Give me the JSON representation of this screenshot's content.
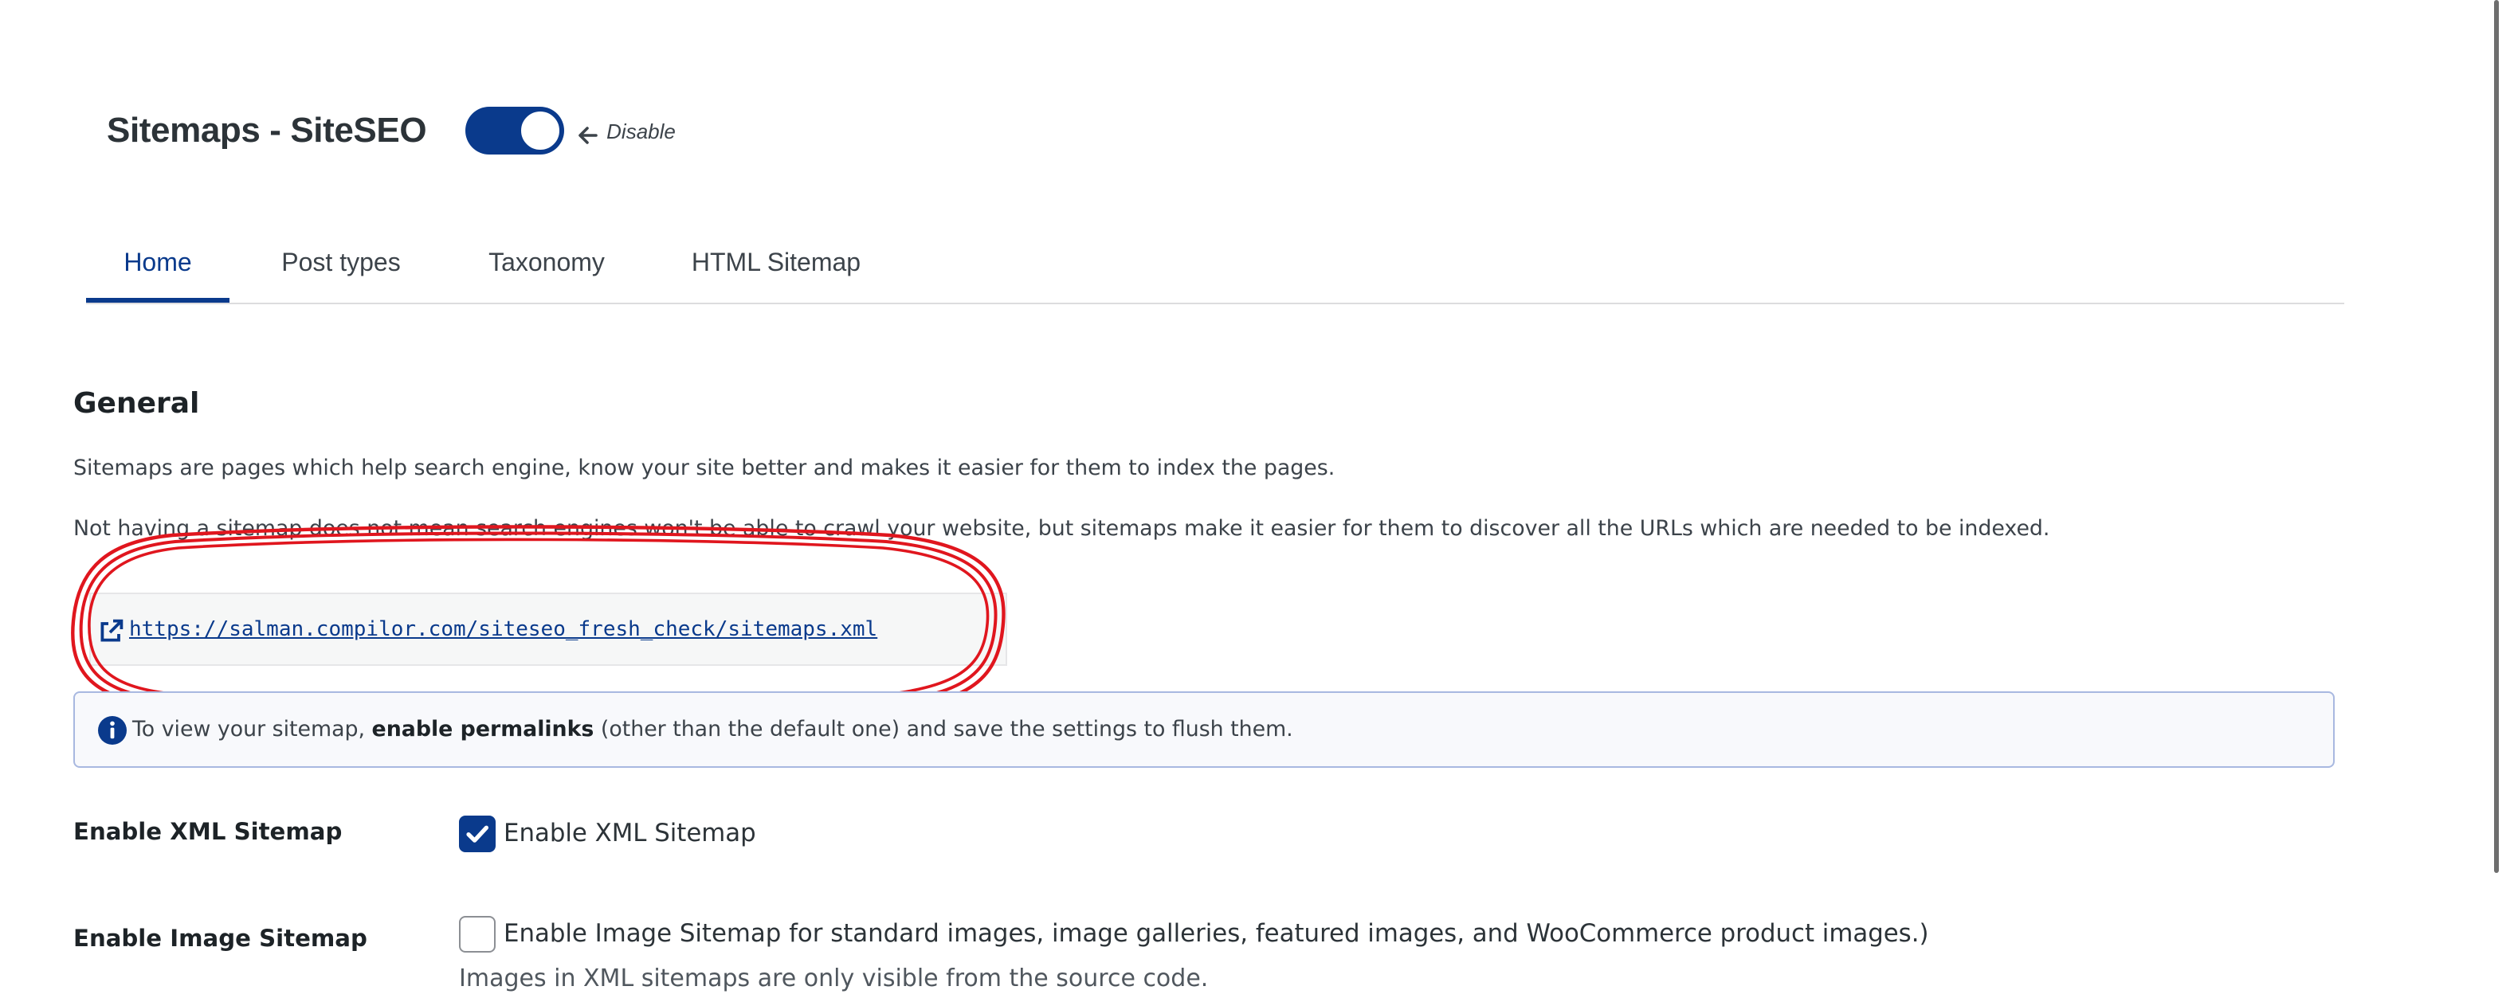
{
  "header": {
    "title": "Sitemaps - SiteSEO",
    "toggle_label": "Disable",
    "toggle_on": true,
    "accent_color": "#0a3a8c"
  },
  "tabs": [
    {
      "label": "Home",
      "active": true
    },
    {
      "label": "Post types",
      "active": false
    },
    {
      "label": "Taxonomy",
      "active": false
    },
    {
      "label": "HTML Sitemap",
      "active": false
    }
  ],
  "general": {
    "title": "General",
    "description_1": "Sitemaps are pages which help search engine, know your site better and makes it easier for them to index the pages.",
    "description_2": "Not having a sitemap does not mean search engines won't be able to crawl your website, but sitemaps make it easier for them to discover all the URLs which are needed to be indexed.",
    "sitemap_url": "https://salman.compilor.com/siteseo_fresh_check/sitemaps.xml",
    "link_icon": "external-link-icon",
    "highlight_color": "#e0161e"
  },
  "notice": {
    "icon": "info-icon",
    "text_before": "To view your sitemap, ",
    "text_bold": "enable permalinks",
    "text_after": " (other than the default one) and save the settings to flush them."
  },
  "settings": {
    "xml_sitemap": {
      "label": "Enable XML Sitemap",
      "checkbox_label": "Enable XML Sitemap",
      "checked": true
    },
    "image_sitemap": {
      "label": "Enable Image Sitemap",
      "checkbox_label": "Enable Image Sitemap for standard images, image galleries, featured images, and WooCommerce product images.)",
      "checked": false,
      "help": "Images in XML sitemaps are only visible from the source code."
    }
  }
}
